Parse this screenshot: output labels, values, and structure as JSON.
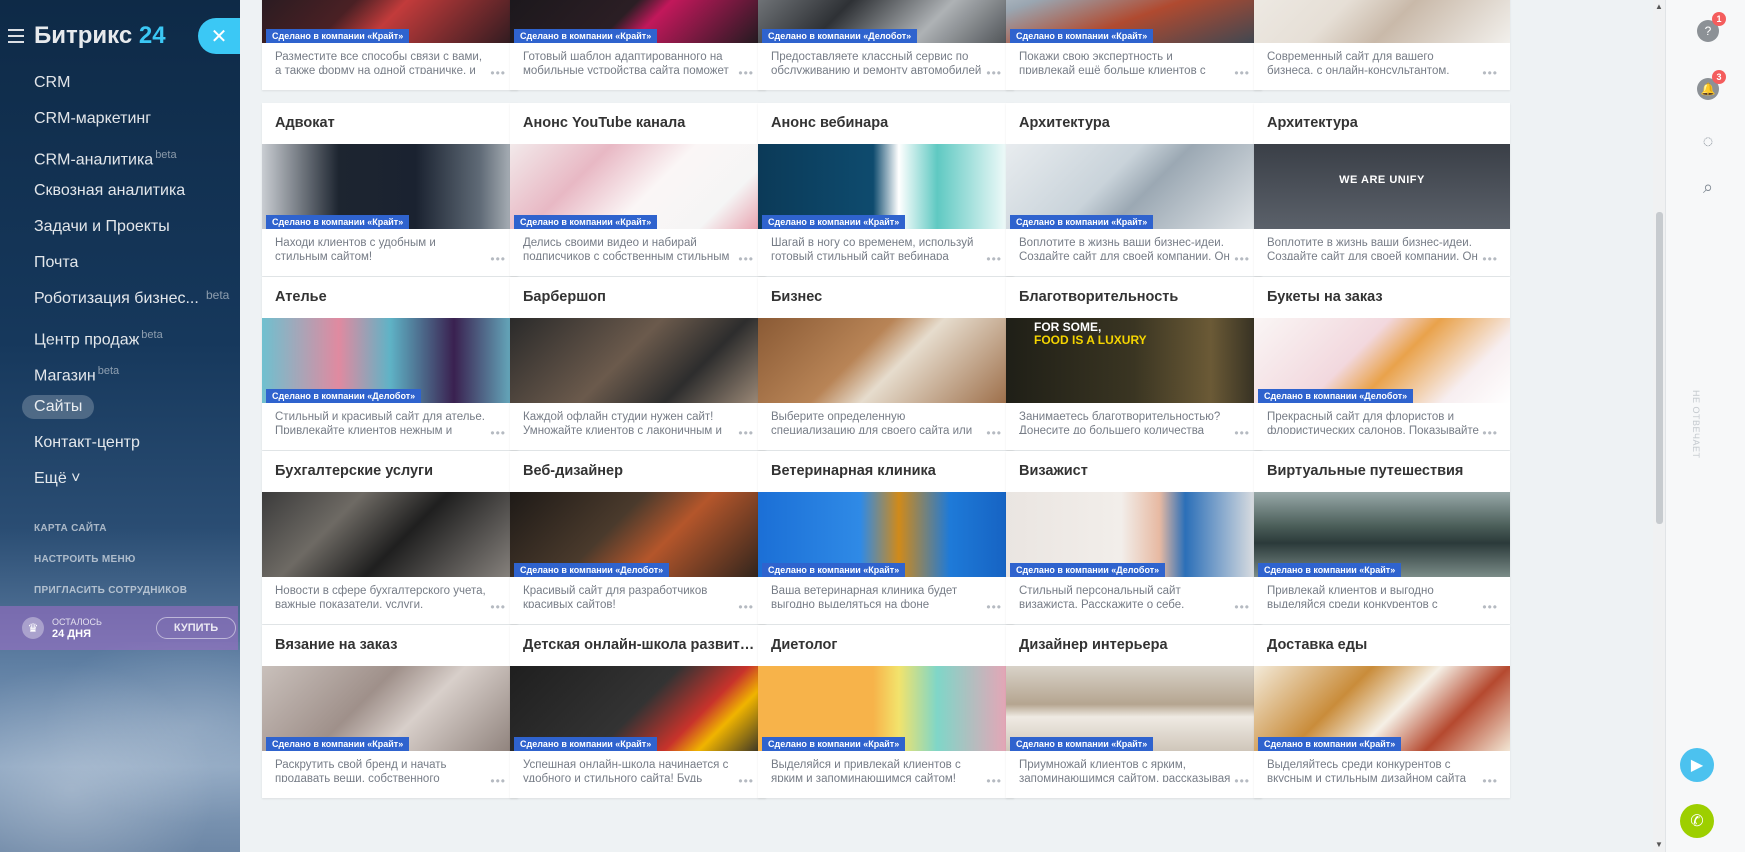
{
  "sidebar": {
    "logo_text": "Битрикс",
    "logo_num": "24",
    "menu": [
      {
        "label": "CRM",
        "badge": ""
      },
      {
        "label": "CRM-маркетинг",
        "badge": ""
      },
      {
        "label": "CRM-аналитика",
        "badge": "beta"
      },
      {
        "label": "Сквозная аналитика",
        "badge": ""
      },
      {
        "label": "Задачи и Проекты",
        "badge": ""
      },
      {
        "label": "Почта",
        "badge": ""
      },
      {
        "label": "Роботизация бизнес...",
        "badge": "beta"
      },
      {
        "label": "Центр продаж",
        "badge": "beta"
      },
      {
        "label": "Магазин",
        "badge": "beta"
      },
      {
        "label": "Сайты",
        "badge": ""
      },
      {
        "label": "Контакт-центр",
        "badge": ""
      },
      {
        "label": "Ещё ˅",
        "badge": ""
      }
    ],
    "links": [
      "КАРТА САЙТА",
      "НАСТРОИТЬ МЕНЮ",
      "ПРИГЛАСИТЬ СОТРУДНИКОВ"
    ],
    "trial_line1": "ОСТАЛОСЬ",
    "trial_line2": "24 ДНЯ",
    "buy_label": "КУПИТЬ"
  },
  "right_panel": {
    "help_count": "1",
    "notify_count": "3",
    "vertical_label": "НЕ ОТВЕЧАЕТ"
  },
  "cards": [
    {
      "title": "",
      "badge": "Сделано в компании «Крайт»",
      "desc": "Разместите все способы связи с вами, а также форму на одной страничке, и",
      "img": "img-red"
    },
    {
      "title": "",
      "badge": "Сделано в компании «Крайт»",
      "desc": "Готовый шаблон адаптированного на мобильные устройства сайта поможет",
      "img": "img-dark"
    },
    {
      "title": "",
      "badge": "Сделано в компании «Делобот»",
      "desc": "Предоставляете классный сервис по обслуживанию и ремонту автомобилей",
      "img": "img-gray"
    },
    {
      "title": "",
      "badge": "Сделано в компании «Крайт»",
      "desc": "Покажи свою экспертность и привлекай ещё больше клиентов с красивым и",
      "img": "img-house"
    },
    {
      "title": "",
      "badge": "",
      "desc": "Современный сайт для вашего бизнеса, с онлайн-консультантом, обратным",
      "img": "img-light"
    },
    {
      "title": "Адвокат",
      "badge": "Сделано в компании «Крайт»",
      "desc": "Находи клиентов с удобным и стильным сайтом!",
      "img": "img-suit"
    },
    {
      "title": "Анонс YouTube канала",
      "badge": "Сделано в компании «Крайт»",
      "desc": "Делись своими видео и набирай подписчиков с собственным стильным",
      "img": "img-flowers"
    },
    {
      "title": "Анонс вебинара",
      "badge": "Сделано в компании «Крайт»",
      "desc": "Шагай в ногу со временем, используй готовый стильный сайт вебинара \"Каждый",
      "img": "img-webinar"
    },
    {
      "title": "Архитектура",
      "badge": "Сделано в компании «Крайт»",
      "desc": "Воплотите в жизнь ваши бизнес-идеи. Создайте сайт для своей компании. Он",
      "img": "img-arch1"
    },
    {
      "title": "Архитектура",
      "badge": "",
      "desc": "Воплотите в жизнь ваши бизнес-идеи. Создайте сайт для своей компании. Он",
      "img": "img-arch2",
      "img_text": "WE ARE UNIFY"
    },
    {
      "title": "Ателье",
      "badge": "Сделано в компании «Делобот»",
      "desc": "Стильный и красивый сайт для ателье. Привлекайте клиентов нежным и",
      "img": "img-thread"
    },
    {
      "title": "Барбершоп",
      "badge": "",
      "desc": "Каждой офлайн студии нужен сайт! Умножайте клиентов с лаконичным и",
      "img": "img-barber"
    },
    {
      "title": "Бизнес",
      "badge": "",
      "desc": "Выберите определенную специализацию для своего сайта или предложите сразу",
      "img": "img-desk"
    },
    {
      "title": "Благотворительность",
      "badge": "",
      "desc": "Занимаетесь благотворительностью? Донесите до большего количества людей",
      "img": "img-luxury",
      "img_text_1": "FOR SOME,",
      "img_text_2": "FOOD IS A LUXURY"
    },
    {
      "title": "Букеты на заказ",
      "badge": "Сделано в компании «Делобот»",
      "desc": "Прекрасный сайт для флористов и флористических салонов. Показывайте",
      "img": "img-bouquet"
    },
    {
      "title": "Бухгалтерские услуги",
      "badge": "",
      "desc": "Новости в сфере бухгалтерского учета, важные показатели, услуги, тематические",
      "img": "img-office"
    },
    {
      "title": "Веб-дизайнер",
      "badge": "Сделано в компании «Делобот»",
      "desc": "Красивый сайт для разработчиков красивых сайтов!",
      "img": "img-designer"
    },
    {
      "title": "Ветеринарная клиника",
      "badge": "Сделано в компании «Крайт»",
      "desc": "Ваша ветеринарная клиника будет выгодно выделяться на фоне остальных",
      "img": "img-parrot"
    },
    {
      "title": "Визажист",
      "badge": "Сделано в компании «Делобот»",
      "desc": "Стильный персональный сайт визажиста. Расскажите о себе. Покажите свои работы",
      "img": "img-makeup"
    },
    {
      "title": "Виртуальные путешествия",
      "badge": "Сделано в компании «Крайт»",
      "desc": "Привлекай клиентов и выгодно выделяйся среди конкурентов с",
      "img": "img-lake"
    },
    {
      "title": "Вязание на заказ",
      "badge": "Сделано в компании «Крайт»",
      "desc": "Раскрутить свой бренд и начать продавать вещи, собственного",
      "img": "img-knit"
    },
    {
      "title": "Детская онлайн-школа развития",
      "badge": "Сделано в компании «Крайт»",
      "desc": "Успешная онлайн-школа начинается с удобного и стильного сайта! Будь",
      "img": "img-pencils"
    },
    {
      "title": "Диетолог",
      "badge": "Сделано в компании «Крайт»",
      "desc": "Выделяйся и привлекай клиентов с ярким и запоминающимся сайтом!",
      "img": "img-diet"
    },
    {
      "title": "Дизайнер интерьера",
      "badge": "Сделано в компании «Крайт»",
      "desc": "Приумножай клиентов с ярким, запоминающимся сайтом, рассказывая",
      "img": "img-interior"
    },
    {
      "title": "Доставка еды",
      "badge": "Сделано в компании «Крайт»",
      "desc": "Выделяйтесь среди конкурентов с вкусным и стильным дизайном сайта",
      "img": "img-food"
    }
  ]
}
